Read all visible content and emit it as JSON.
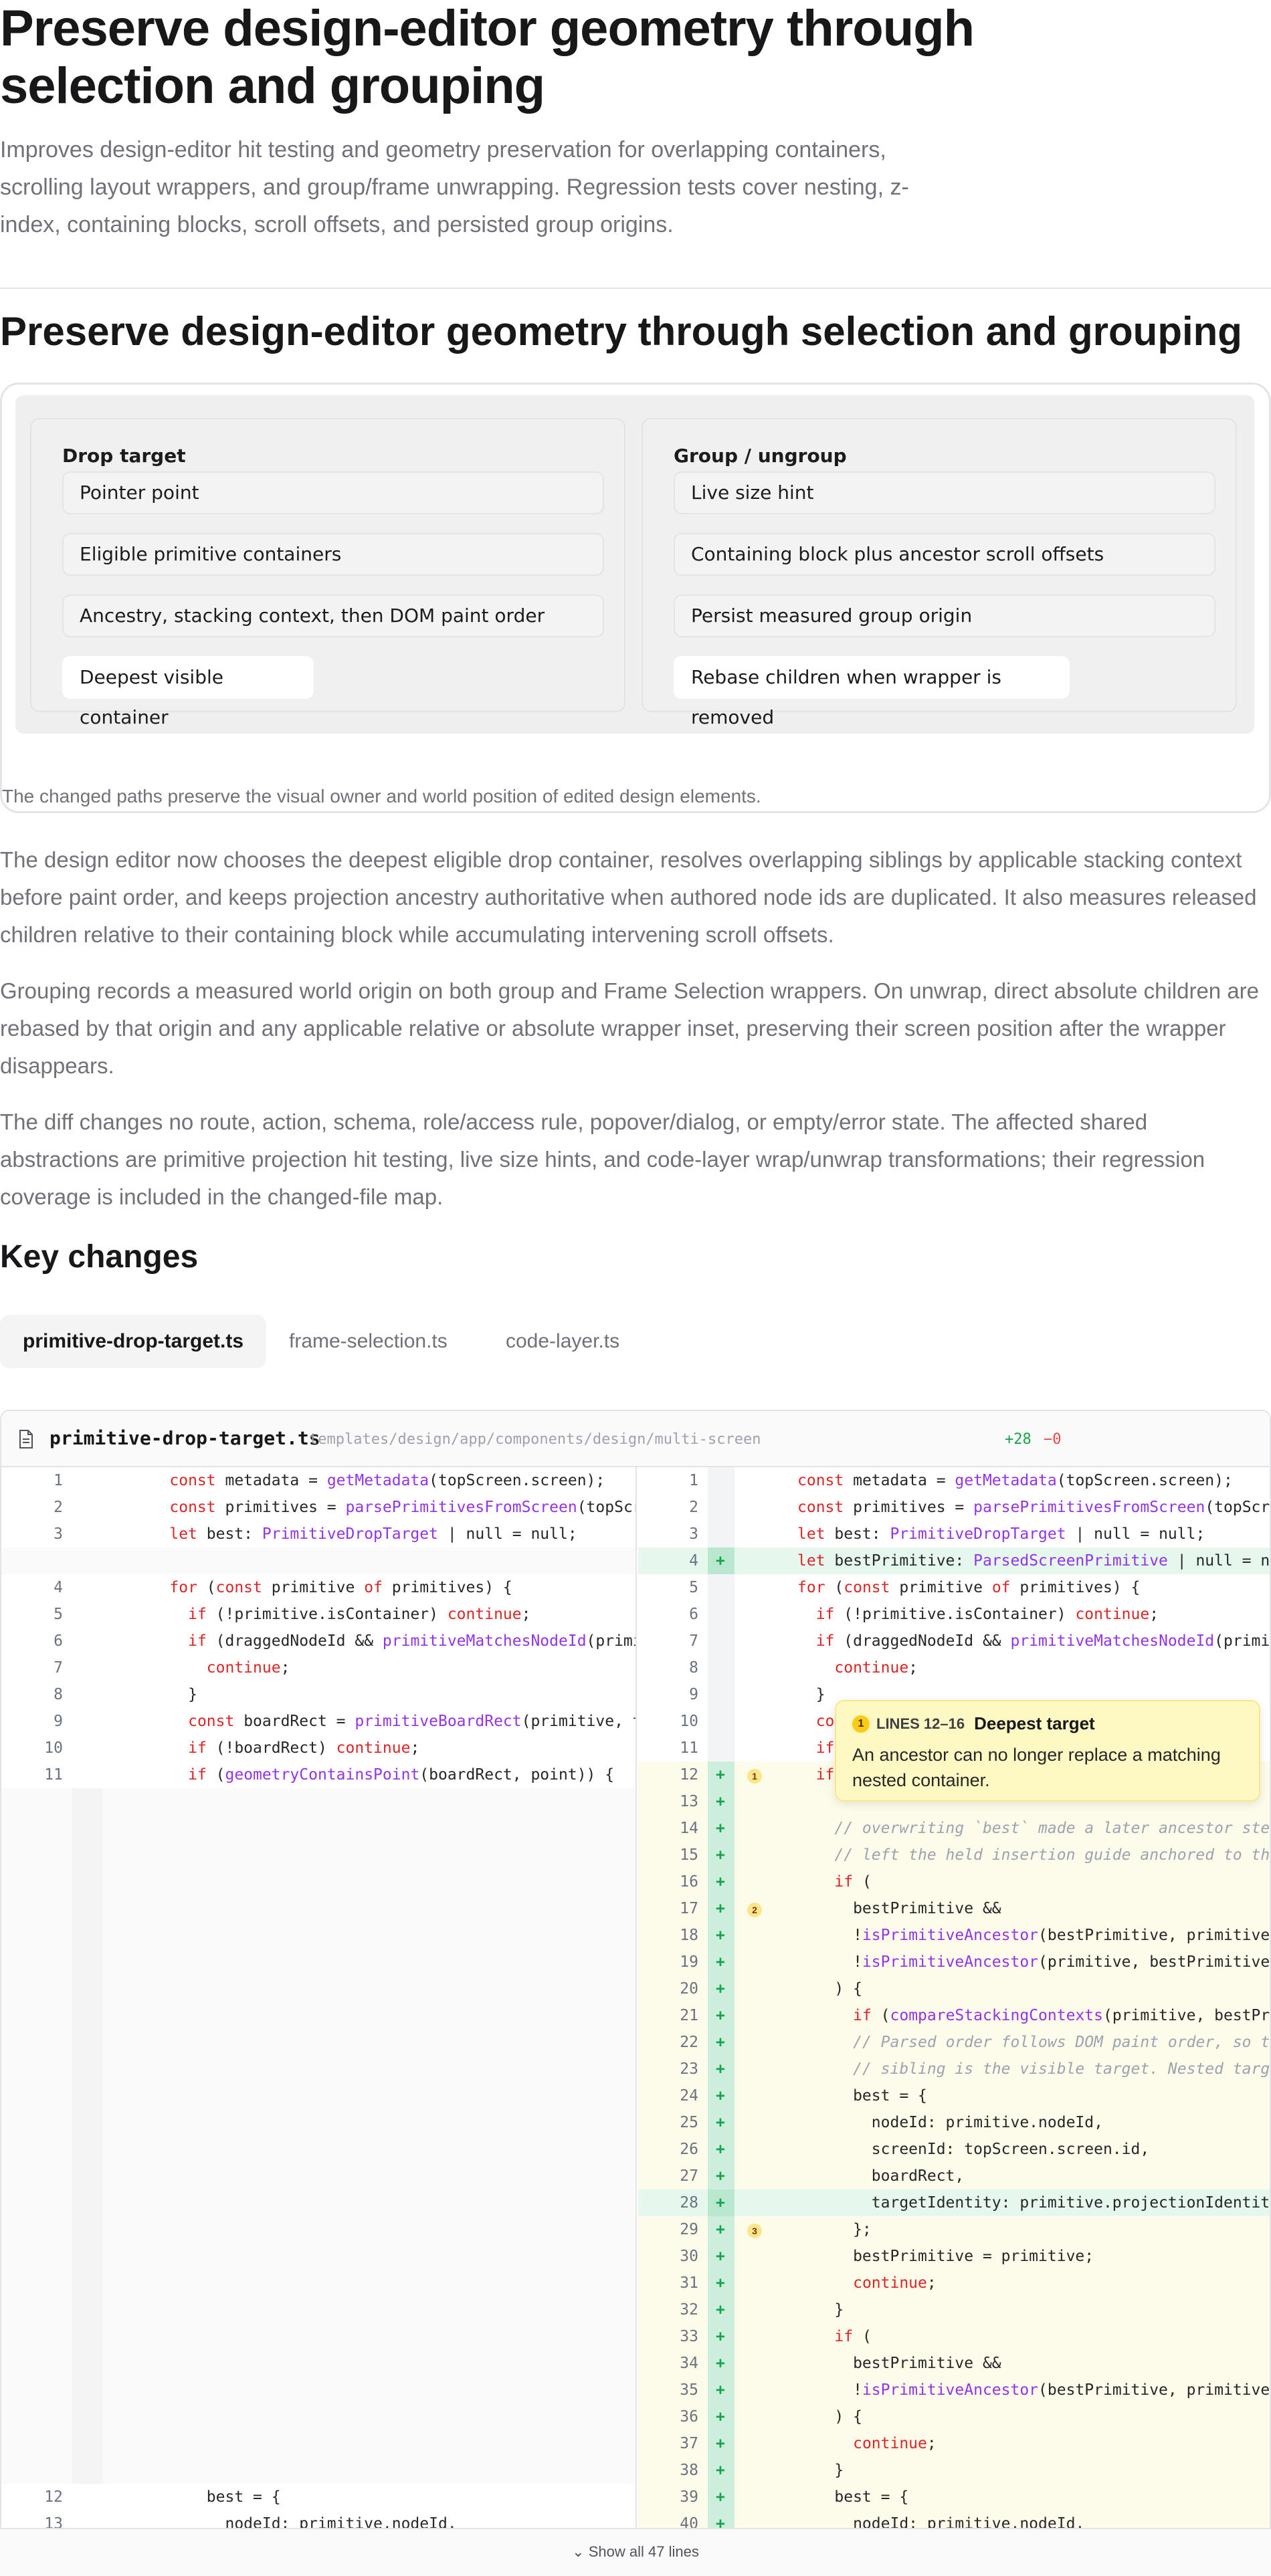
{
  "page": {
    "title": "Preserve design-editor geometry through selection and grouping",
    "lede": "Improves design-editor hit testing and geometry preservation for overlapping containers, scrolling layout wrappers, and group/frame unwrapping. Regression tests cover nesting, z-index, containing blocks, scroll offsets, and persisted group origins.",
    "section_title": "Preserve design-editor geometry through selection and grouping"
  },
  "figure": {
    "left_title": "Drop target",
    "left_items": [
      "Pointer point",
      "Eligible primitive containers",
      "Ancestry, stacking context, then DOM paint order",
      "Deepest visible container"
    ],
    "right_title": "Group / ungroup",
    "right_items": [
      "Live size hint",
      "Containing block plus ancestor scroll offsets",
      "Persist measured group origin",
      "Rebase children when wrapper is removed"
    ],
    "caption": "The changed paths preserve the visual owner and world position of edited design elements."
  },
  "paragraphs": [
    "The design editor now chooses the deepest eligible drop container, resolves overlapping siblings by applicable stacking context before paint order, and keeps projection ancestry authoritative when authored node ids are duplicated. It also measures released children relative to their containing block while accumulating intervening scroll offsets.",
    "Grouping records a measured world origin on both group and Frame Selection wrappers. On unwrap, direct absolute children are rebased by that origin and any applicable relative or absolute wrapper inset, preserving their screen position after the wrapper disappears.",
    "The diff changes no route, action, schema, role/access rule, popover/dialog, or empty/error state. The affected shared abstractions are primitive projection hit testing, live size hints, and code-layer wrap/unwrap transformations; their regression coverage is included in the changed-file map."
  ],
  "key_changes": {
    "title": "Key changes",
    "tabs": [
      "primitive-drop-target.ts",
      "frame-selection.ts",
      "code-layer.ts"
    ],
    "active_tab": 0
  },
  "diff": {
    "file_name": "primitive-drop-target.ts",
    "file_path": "templates/design/app/components/design/multi-screen",
    "additions": "+28",
    "deletions": "−0",
    "icon": "file-icon",
    "show_all": "Show all 47 lines",
    "left_lines": [
      {
        "n": "1",
        "html": "    <span class='kw'>const</span> metadata = <span class='fn'>getMetadata</span>(topScreen.screen);"
      },
      {
        "n": "2",
        "html": "    <span class='kw'>const</span> primitives = <span class='fn'>parsePrimitivesFromScreen</span>(topScreen.s"
      },
      {
        "n": "3",
        "html": "    <span class='kw'>let</span> best: <span class='fn'>PrimitiveDropTarget</span> | null = null;"
      },
      {
        "n": "",
        "html": ""
      },
      {
        "n": "4",
        "html": "    <span class='kw'>for</span> (<span class='kw'>const</span> primitive <span class='kw'>of</span> primitives) {"
      },
      {
        "n": "5",
        "html": "      <span class='kw'>if</span> (!primitive.isContainer) <span class='kw'>continue</span>;"
      },
      {
        "n": "6",
        "html": "      <span class='kw'>if</span> (draggedNodeId &amp;&amp; <span class='fn'>primitiveMatchesNodeId</span>(primitive,"
      },
      {
        "n": "7",
        "html": "        <span class='kw'>continue</span>;"
      },
      {
        "n": "8",
        "html": "      }"
      },
      {
        "n": "9",
        "html": "      <span class='kw'>const</span> boardRect = <span class='fn'>primitiveBoardRect</span>(primitive, topScr"
      },
      {
        "n": "10",
        "html": "      <span class='kw'>if</span> (!boardRect) <span class='kw'>continue</span>;"
      },
      {
        "n": "11",
        "html": "      <span class='kw'>if</span> (<span class='fn'>geometryContainsPoint</span>(boardRect, point)) {"
      }
    ],
    "left_tail": [
      {
        "n": "12",
        "html": "        best = {"
      },
      {
        "n": "13",
        "html": "          nodeId: primitive.nodeId,"
      }
    ],
    "right_lines": [
      {
        "n": "1",
        "t": "",
        "b": "",
        "html": "<span class='kw'>const</span> metadata = <span class='fn'>getMetadata</span>(topScreen.screen);"
      },
      {
        "n": "2",
        "t": "",
        "b": "",
        "html": "<span class='kw'>const</span> primitives = <span class='fn'>parsePrimitivesFromScreen</span>(topScree"
      },
      {
        "n": "3",
        "t": "",
        "b": "",
        "html": "<span class='kw'>let</span> best: <span class='fn'>PrimitiveDropTarget</span> | null = null;"
      },
      {
        "n": "4",
        "t": "ins",
        "b": "",
        "html": "<span class='kw'>let</span> bestPrimitive: <span class='fn'>ParsedScreenPrimitive</span> | null = nul"
      },
      {
        "n": "5",
        "t": "",
        "b": "",
        "html": "<span class='kw'>for</span> (<span class='kw'>const</span> primitive <span class='kw'>of</span> primitives) {"
      },
      {
        "n": "6",
        "t": "",
        "b": "",
        "html": "  <span class='kw'>if</span> (!primitive.isContainer) <span class='kw'>continue</span>;"
      },
      {
        "n": "7",
        "t": "",
        "b": "",
        "html": "  <span class='kw'>if</span> (draggedNodeId &amp;&amp; <span class='fn'>primitiveMatchesNodeId</span>(primiti"
      },
      {
        "n": "8",
        "t": "",
        "b": "",
        "html": "    <span class='kw'>continue</span>;"
      },
      {
        "n": "9",
        "t": "",
        "b": "",
        "html": "  }"
      },
      {
        "n": "10",
        "t": "",
        "b": "",
        "html": "  <span class='kw'>co</span>"
      },
      {
        "n": "11",
        "t": "",
        "b": "",
        "html": "  <span class='kw'>if</span>"
      },
      {
        "n": "12",
        "t": "add",
        "b": "1",
        "html": "  <span class='kw'>if</span>"
      },
      {
        "n": "13",
        "t": "add",
        "b": "",
        "html": ""
      },
      {
        "n": "14",
        "t": "add",
        "b": "",
        "html": "    <span class='cm'>// overwriting `best` made a later ancestor stea</span>"
      },
      {
        "n": "15",
        "t": "add",
        "b": "",
        "html": "    <span class='cm'>// left the held insertion guide anchored to the</span>"
      },
      {
        "n": "16",
        "t": "add",
        "b": "",
        "html": "    <span class='kw'>if</span> ("
      },
      {
        "n": "17",
        "t": "add",
        "b": "2",
        "html": "      bestPrimitive &amp;&amp;"
      },
      {
        "n": "18",
        "t": "add",
        "b": "",
        "html": "      !<span class='fn'>isPrimitiveAncestor</span>(bestPrimitive, primitive,"
      },
      {
        "n": "19",
        "t": "add",
        "b": "",
        "html": "      !<span class='fn'>isPrimitiveAncestor</span>(primitive, bestPrimitive,"
      },
      {
        "n": "20",
        "t": "add",
        "b": "",
        "html": "    ) {"
      },
      {
        "n": "21",
        "t": "add",
        "b": "",
        "html": "      <span class='kw'>if</span> (<span class='fn'>compareStackingContexts</span>(primitive, bestPri"
      },
      {
        "n": "22",
        "t": "add",
        "b": "",
        "html": "      <span class='cm'>// Parsed order follows DOM paint order, so the</span>"
      },
      {
        "n": "23",
        "t": "add",
        "b": "",
        "html": "      <span class='cm'>// sibling is the visible target. Nested target</span>"
      },
      {
        "n": "24",
        "t": "add",
        "b": "",
        "html": "      best = {"
      },
      {
        "n": "25",
        "t": "add",
        "b": "",
        "html": "        nodeId: primitive.nodeId,"
      },
      {
        "n": "26",
        "t": "add",
        "b": "",
        "html": "        screenId: topScreen.screen.id,"
      },
      {
        "n": "27",
        "t": "add",
        "b": "",
        "html": "        boardRect,"
      },
      {
        "n": "28",
        "t": "ins",
        "b": "",
        "html": "        targetIdentity: primitive.projectionIdentity,"
      },
      {
        "n": "29",
        "t": "add",
        "b": "3",
        "html": "      };"
      },
      {
        "n": "30",
        "t": "add",
        "b": "",
        "html": "      bestPrimitive = primitive;"
      },
      {
        "n": "31",
        "t": "add",
        "b": "",
        "html": "      <span class='kw'>continue</span>;"
      },
      {
        "n": "32",
        "t": "add",
        "b": "",
        "html": "    }"
      },
      {
        "n": "33",
        "t": "add",
        "b": "",
        "html": "    <span class='kw'>if</span> ("
      },
      {
        "n": "34",
        "t": "add",
        "b": "",
        "html": "      bestPrimitive &amp;&amp;"
      },
      {
        "n": "35",
        "t": "add",
        "b": "",
        "html": "      !<span class='fn'>isPrimitiveAncestor</span>(bestPrimitive, primitive,"
      },
      {
        "n": "36",
        "t": "add",
        "b": "",
        "html": "    ) {"
      },
      {
        "n": "37",
        "t": "add",
        "b": "",
        "html": "      <span class='kw'>continue</span>;"
      },
      {
        "n": "38",
        "t": "add",
        "b": "",
        "html": "    }"
      },
      {
        "n": "39",
        "t": "add",
        "b": "",
        "html": "    best = {"
      },
      {
        "n": "40",
        "t": "add",
        "b": "",
        "html": "      nodeId: primitive.nodeId,"
      }
    ]
  },
  "callout": {
    "number": "1",
    "lines": "LINES 12–16",
    "title": "Deepest target",
    "body": "An ancestor can no longer replace a matching nested container."
  },
  "colors": {
    "accent_add": "#16a34a",
    "accent_del": "#ef4444",
    "callout_bg": "#fef9c3",
    "text_muted": "#71717a"
  }
}
